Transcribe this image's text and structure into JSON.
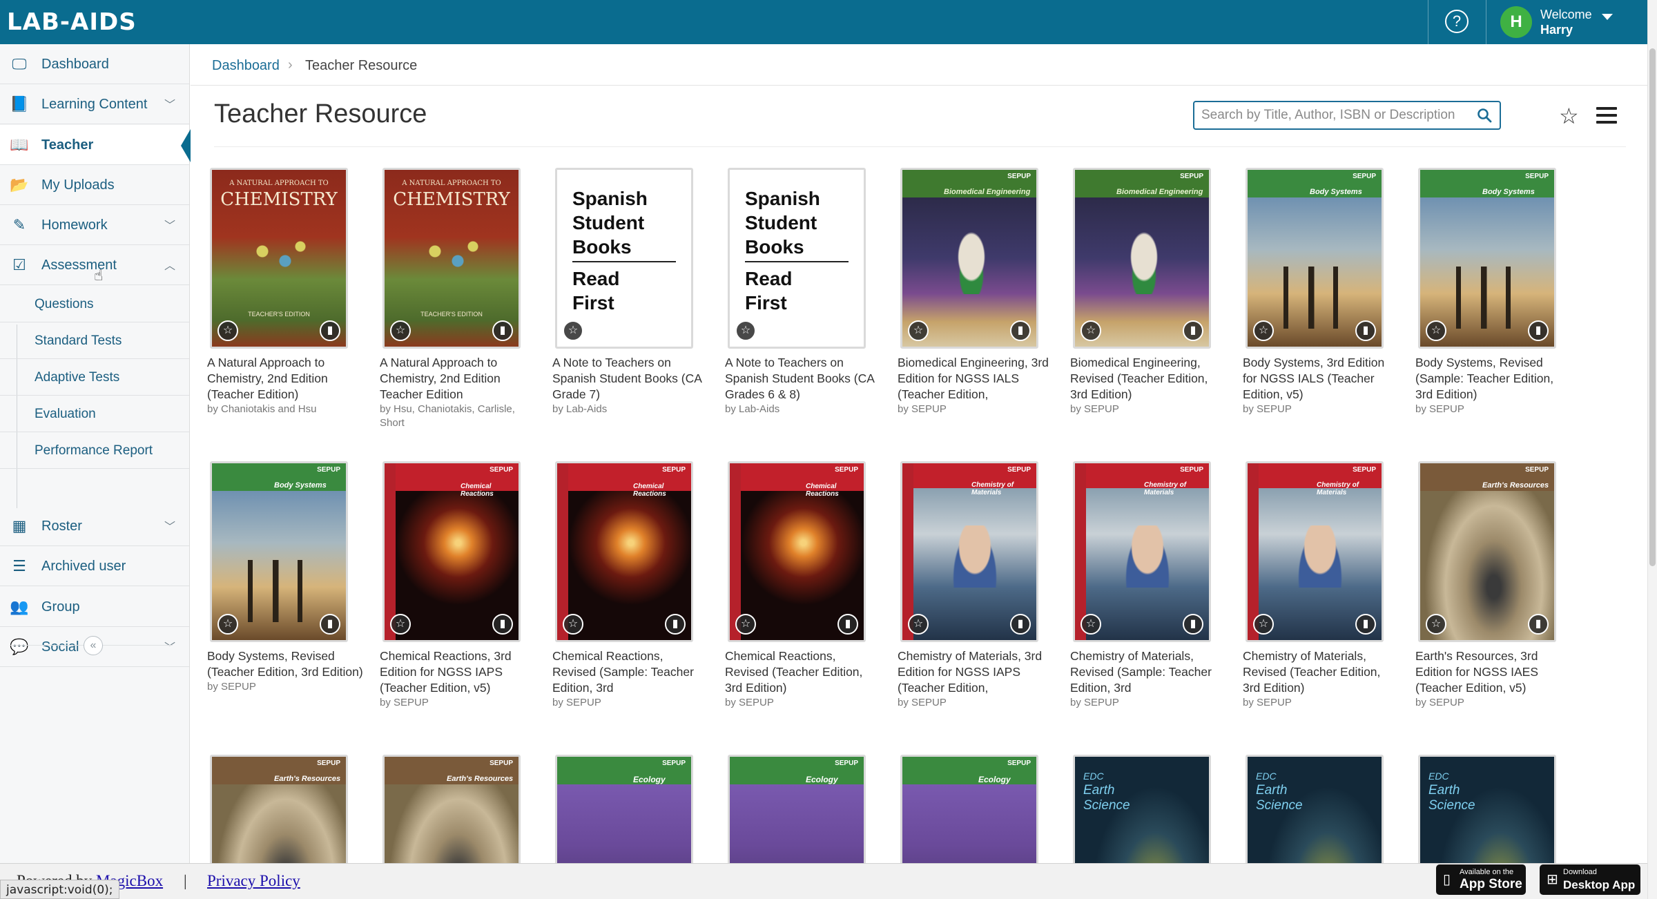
{
  "header": {
    "logo": "LAB-AIDS",
    "help_symbol": "?",
    "user_initial": "H",
    "welcome_label": "Welcome",
    "user_name": "Harry"
  },
  "sidebar": {
    "items": [
      {
        "label": "Dashboard",
        "icon": "monitor-icon",
        "has_chevron": false
      },
      {
        "label": "Learning Content",
        "icon": "book-icon",
        "has_chevron": true
      },
      {
        "label": "Teacher",
        "icon": "teacher-book-icon",
        "has_chevron": false,
        "active": true
      },
      {
        "label": "My Uploads",
        "icon": "folder-icon",
        "has_chevron": false
      },
      {
        "label": "Homework",
        "icon": "pencil-icon",
        "has_chevron": true
      },
      {
        "label": "Assessment",
        "icon": "checkbox-icon",
        "has_chevron": true,
        "expanded": true
      },
      {
        "label": "Roster",
        "icon": "calendar-icon",
        "has_chevron": true
      },
      {
        "label": "Archived user",
        "icon": "list-icon",
        "has_chevron": false
      },
      {
        "label": "Group",
        "icon": "users-icon",
        "has_chevron": false
      },
      {
        "label": "Social",
        "icon": "chat-icon",
        "has_chevron": true
      }
    ],
    "assessment_sub": [
      "Questions",
      "Standard Tests",
      "Adaptive Tests",
      "Evaluation",
      "Performance Report"
    ],
    "collapse_symbol": "«"
  },
  "breadcrumb": {
    "home": "Dashboard",
    "separator": "›",
    "current": "Teacher Resource"
  },
  "main": {
    "title": "Teacher Resource",
    "search_placeholder": "Search by Title, Author, ISBN or Description"
  },
  "books": [
    {
      "title": "A Natural Approach to Chemistry, 2nd Edition (Teacher Edition)",
      "author": "by Chaniotakis and Hsu",
      "cover": "chemistry",
      "stats": true
    },
    {
      "title": "A Natural Approach to Chemistry, 2nd Edition Teacher Edition",
      "author": "by Hsu, Chaniotakis, Carlisle, Short",
      "cover": "chemistry",
      "stats": true
    },
    {
      "title": "A Note to Teachers on Spanish Student Books (CA Grade 7)",
      "author": "by Lab-Aids",
      "cover": "spanish",
      "stats": false
    },
    {
      "title": "A Note to Teachers on Spanish Student Books (CA Grades 6 & 8)",
      "author": "by Lab-Aids",
      "cover": "spanish",
      "stats": false
    },
    {
      "title": "Biomedical Engineering, 3rd Edition for NGSS IALS (Teacher Edition,",
      "author": "by SEPUP",
      "cover": "biomed",
      "stats": true
    },
    {
      "title": "Biomedical Engineering, Revised (Teacher Edition, 3rd Edition)",
      "author": "by SEPUP",
      "cover": "biomed",
      "stats": true
    },
    {
      "title": "Body Systems, 3rd Edition for NGSS IALS (Teacher Edition, v5)",
      "author": "by SEPUP",
      "cover": "body",
      "stats": true
    },
    {
      "title": "Body Systems, Revised (Sample: Teacher Edition, 3rd Edition)",
      "author": "by SEPUP",
      "cover": "body",
      "stats": true
    },
    {
      "title": "Body Systems, Revised (Teacher Edition, 3rd Edition)",
      "author": "by SEPUP",
      "cover": "body",
      "stats": true
    },
    {
      "title": "Chemical Reactions, 3rd Edition for NGSS IAPS (Teacher Edition, v5)",
      "author": "by SEPUP",
      "cover": "chemreact",
      "stats": true
    },
    {
      "title": "Chemical Reactions, Revised (Sample: Teacher Edition, 3rd",
      "author": "by SEPUP",
      "cover": "chemreact",
      "stats": true
    },
    {
      "title": "Chemical Reactions, Revised (Teacher Edition, 3rd Edition)",
      "author": "by SEPUP",
      "cover": "chemreact",
      "stats": true
    },
    {
      "title": "Chemistry of Materials, 3rd Edition for NGSS IAPS (Teacher Edition,",
      "author": "by SEPUP",
      "cover": "materials",
      "stats": true
    },
    {
      "title": "Chemistry of Materials, Revised (Sample: Teacher Edition, 3rd",
      "author": "by SEPUP",
      "cover": "materials",
      "stats": true
    },
    {
      "title": "Chemistry of Materials, Revised (Teacher Edition, 3rd Edition)",
      "author": "by SEPUP",
      "cover": "materials",
      "stats": true
    },
    {
      "title": "Earth's Resources, 3rd Edition for NGSS IAES (Teacher Edition, v5)",
      "author": "by SEPUP",
      "cover": "earthres",
      "stats": true
    },
    {
      "title": "",
      "author": "",
      "cover": "earthres",
      "stats": true
    },
    {
      "title": "",
      "author": "",
      "cover": "earthres",
      "stats": true
    },
    {
      "title": "",
      "author": "",
      "cover": "ecology",
      "stats": true
    },
    {
      "title": "",
      "author": "",
      "cover": "ecology",
      "stats": true
    },
    {
      "title": "",
      "author": "",
      "cover": "ecology",
      "stats": true
    },
    {
      "title": "",
      "author": "",
      "cover": "earthsci",
      "stats": true
    },
    {
      "title": "",
      "author": "",
      "cover": "earthsci",
      "stats": true
    },
    {
      "title": "",
      "author": "",
      "cover": "earthsci",
      "stats": true
    }
  ],
  "cover_text": {
    "chemistry_a": "A NATURAL APPROACH TO",
    "chemistry_b": "CHEMISTRY",
    "chemistry_c": "TEACHER'S EDITION",
    "spanish_a": "Spanish Student Books",
    "spanish_b": "Read First",
    "sepup": "SEPUP",
    "biomed": "Biomedical Engineering",
    "body": "Body Systems",
    "chemreact": "Chemical Reactions",
    "materials": "Chemistry of Materials",
    "earthres": "Earth's Resources",
    "ecology": "Ecology",
    "earthsci_a": "EDC",
    "earthsci_b": "Earth Science"
  },
  "footer": {
    "powered_prefix": "Powered by",
    "powered_link": "MagicBox",
    "separator": "|",
    "privacy": "Privacy Policy",
    "appstore_small": "Available on the",
    "appstore_big": "App Store",
    "desktop_small": "Download",
    "desktop_big": "Desktop App",
    "status_text": "javascript:void(0);"
  },
  "colors": {
    "topbar": "#0a6c8f",
    "link": "#1b6d96",
    "avatar": "#3fb143"
  }
}
